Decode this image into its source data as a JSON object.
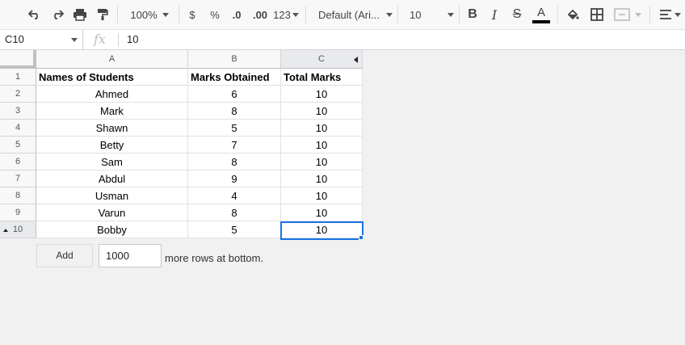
{
  "toolbar": {
    "zoom": "100%",
    "currency": "$",
    "percent": "%",
    "decrease_decimal": ".0",
    "increase_decimal": ".00",
    "number_format": "123",
    "font": "Default (Ari...",
    "font_size": "10",
    "bold": "B",
    "italic": "I",
    "strike": "S",
    "text_color": "A",
    "text_color_value": "#000000"
  },
  "formula_bar": {
    "cell_ref": "C10",
    "fx": "fx",
    "value": "10"
  },
  "grid": {
    "columns": [
      "A",
      "B",
      "C"
    ],
    "row_numbers": [
      "1",
      "2",
      "3",
      "4",
      "5",
      "6",
      "7",
      "8",
      "9",
      "10"
    ],
    "headers": [
      "Names of Students",
      "Marks Obtained",
      "Total Marks"
    ],
    "rows": [
      [
        "Ahmed",
        "6",
        "10"
      ],
      [
        "Mark",
        "8",
        "10"
      ],
      [
        "Shawn",
        "5",
        "10"
      ],
      [
        "Betty",
        "7",
        "10"
      ],
      [
        "Sam",
        "8",
        "10"
      ],
      [
        "Abdul",
        "9",
        "10"
      ],
      [
        "Usman",
        "4",
        "10"
      ],
      [
        "Varun",
        "8",
        "10"
      ],
      [
        "Bobby",
        "5",
        "10"
      ]
    ],
    "selected_cell": "C10"
  },
  "add_rows": {
    "button": "Add",
    "count": "1000",
    "label": "more rows at bottom."
  },
  "colors": {
    "selection": "#1a73e8",
    "header_bg": "#f8f8f8"
  }
}
